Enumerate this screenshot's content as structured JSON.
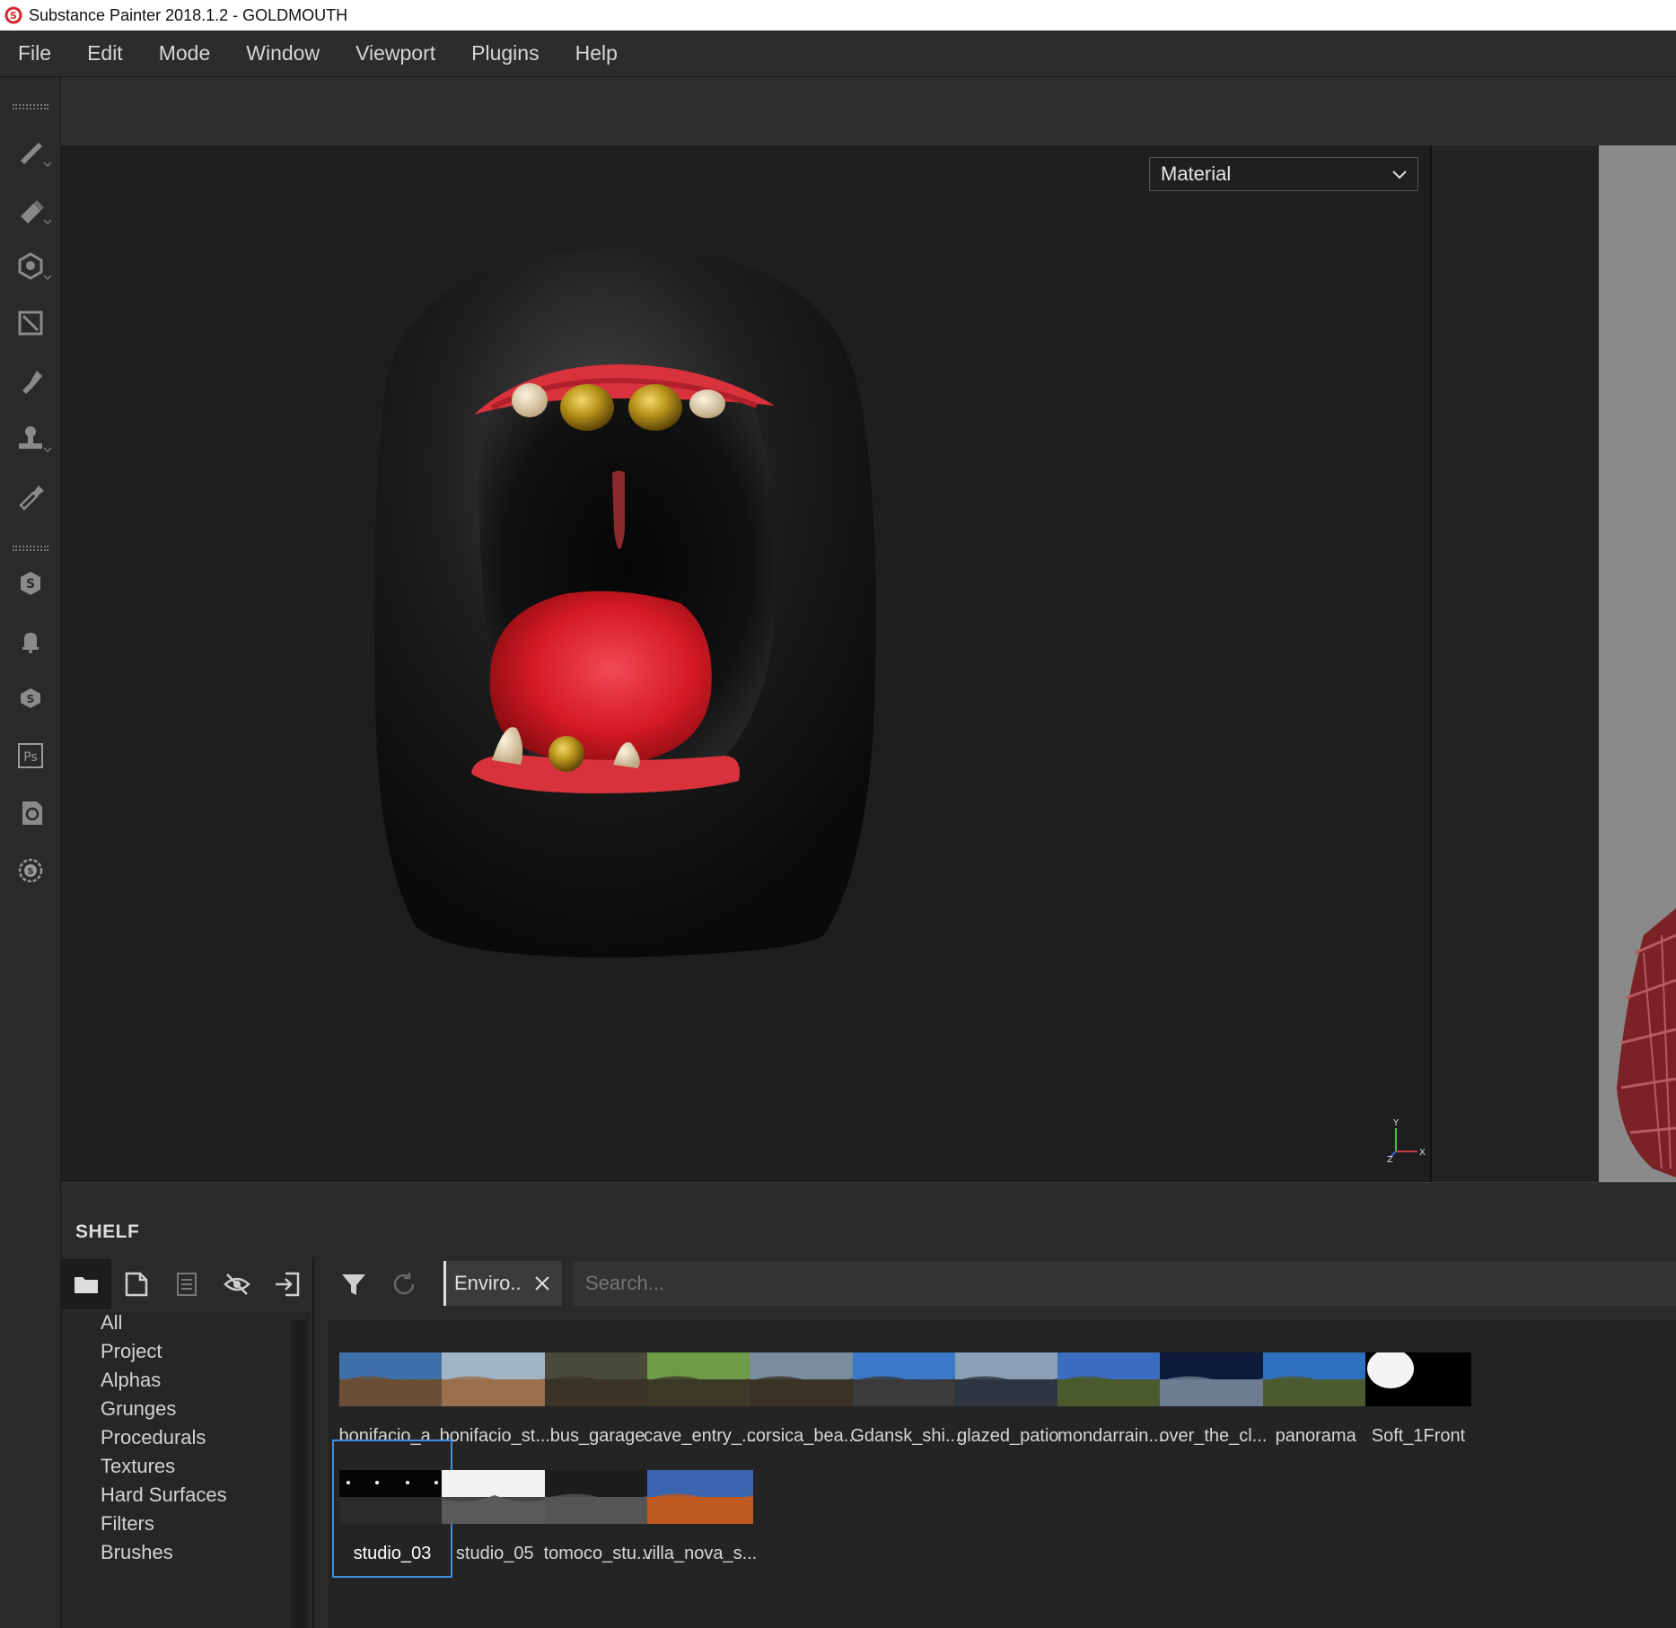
{
  "window": {
    "title": "Substance Painter 2018.1.2 - GOLDMOUTH"
  },
  "menubar": {
    "items": [
      "File",
      "Edit",
      "Mode",
      "Window",
      "Viewport",
      "Plugins",
      "Help"
    ]
  },
  "toolbar": {
    "tools": [
      {
        "name": "paint-brush-icon"
      },
      {
        "name": "eraser-icon"
      },
      {
        "name": "projection-icon"
      },
      {
        "name": "polygon-fill-icon"
      },
      {
        "name": "smudge-icon"
      },
      {
        "name": "clone-stamp-icon"
      },
      {
        "name": "color-picker-icon"
      },
      {
        "name": "substance-share-icon"
      },
      {
        "name": "notification-bell-icon"
      },
      {
        "name": "substance-source-icon"
      },
      {
        "name": "photoshop-icon"
      },
      {
        "name": "sync-icon"
      },
      {
        "name": "substance-logo-icon"
      }
    ]
  },
  "viewport": {
    "mode_dropdown": "Material",
    "axis_labels": {
      "y": "Y",
      "x": "X",
      "z": "Z"
    }
  },
  "shelf": {
    "title": "SHELF",
    "filter_chip": "Enviro..",
    "search_placeholder": "Search...",
    "categories": [
      "All",
      "Project",
      "Alphas",
      "Grunges",
      "Procedurals",
      "Textures",
      "Hard Surfaces",
      "Filters",
      "Brushes"
    ],
    "assets": [
      {
        "label": "bonifacio_a...",
        "sky": "#3f6fa8",
        "ground": "#6b4e36"
      },
      {
        "label": "bonifacio_st...",
        "sky": "#a0b4c8",
        "ground": "#9a6f4c"
      },
      {
        "label": "bus_garage",
        "sky": "#4a4a3a",
        "ground": "#3a3326"
      },
      {
        "label": "cave_entry_...",
        "sky": "#6f9a48",
        "ground": "#3c3a28"
      },
      {
        "label": "corsica_bea...",
        "sky": "#7a8ca0",
        "ground": "#3a3226"
      },
      {
        "label": "Gdansk_shi...",
        "sky": "#3a78c8",
        "ground": "#3b3b3b"
      },
      {
        "label": "glazed_patio",
        "sky": "#8aa0b6",
        "ground": "#2e3440"
      },
      {
        "label": "mondarrain...",
        "sky": "#3a6cc0",
        "ground": "#4a5a2a"
      },
      {
        "label": "over_the_cl...",
        "sky": "#0e1a3a",
        "ground": "#6d7c90"
      },
      {
        "label": "panorama",
        "sky": "#2f6fbf",
        "ground": "#4c5a30"
      },
      {
        "label": "Soft_1Front",
        "sky": "#000000",
        "ground": "#000000"
      },
      {
        "label": "studio_03",
        "sky": "#050505",
        "ground": "#2a2a2a"
      },
      {
        "label": "studio_05",
        "sky": "#f2f2f2",
        "ground": "#444444"
      },
      {
        "label": "tomoco_stu...",
        "sky": "#1c1c1c",
        "ground": "#555555"
      },
      {
        "label": "villa_nova_s...",
        "sky": "#3a66b0",
        "ground": "#c05a20"
      }
    ],
    "selected_asset": "studio_03"
  }
}
